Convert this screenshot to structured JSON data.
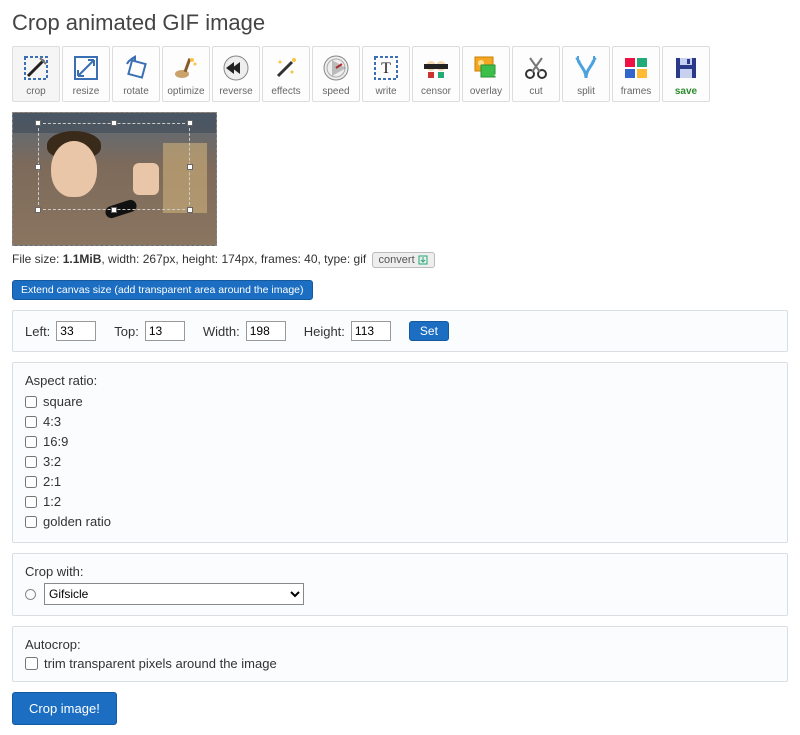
{
  "title": "Crop animated GIF image",
  "toolbar": [
    {
      "key": "crop",
      "label": "crop"
    },
    {
      "key": "resize",
      "label": "resize"
    },
    {
      "key": "rotate",
      "label": "rotate"
    },
    {
      "key": "optimize",
      "label": "optimize"
    },
    {
      "key": "reverse",
      "label": "reverse"
    },
    {
      "key": "effects",
      "label": "effects"
    },
    {
      "key": "speed",
      "label": "speed"
    },
    {
      "key": "write",
      "label": "write"
    },
    {
      "key": "censor",
      "label": "censor"
    },
    {
      "key": "overlay",
      "label": "overlay"
    },
    {
      "key": "cut",
      "label": "cut"
    },
    {
      "key": "split",
      "label": "split"
    },
    {
      "key": "frames",
      "label": "frames"
    },
    {
      "key": "save",
      "label": "save"
    }
  ],
  "active_tool": "crop",
  "fileinfo": {
    "prefix": "File size: ",
    "size_bold": "1.1MiB",
    "rest": ", width: 267px, height: 174px, frames: 40, type: gif",
    "convert_label": "convert"
  },
  "extend_button": "Extend canvas size (add transparent area around the image)",
  "coords": {
    "left_label": "Left:",
    "left": "33",
    "top_label": "Top:",
    "top": "13",
    "width_label": "Width:",
    "width": "198",
    "height_label": "Height:",
    "height": "113",
    "set_label": "Set"
  },
  "aspect": {
    "label": "Aspect ratio:",
    "options": [
      "square",
      "4:3",
      "16:9",
      "3:2",
      "2:1",
      "1:2",
      "golden ratio"
    ]
  },
  "cropwith": {
    "label": "Crop with:",
    "selected": "Gifsicle"
  },
  "autocrop": {
    "label": "Autocrop:",
    "option": "trim transparent pixels around the image"
  },
  "submit_label": "Crop image!"
}
